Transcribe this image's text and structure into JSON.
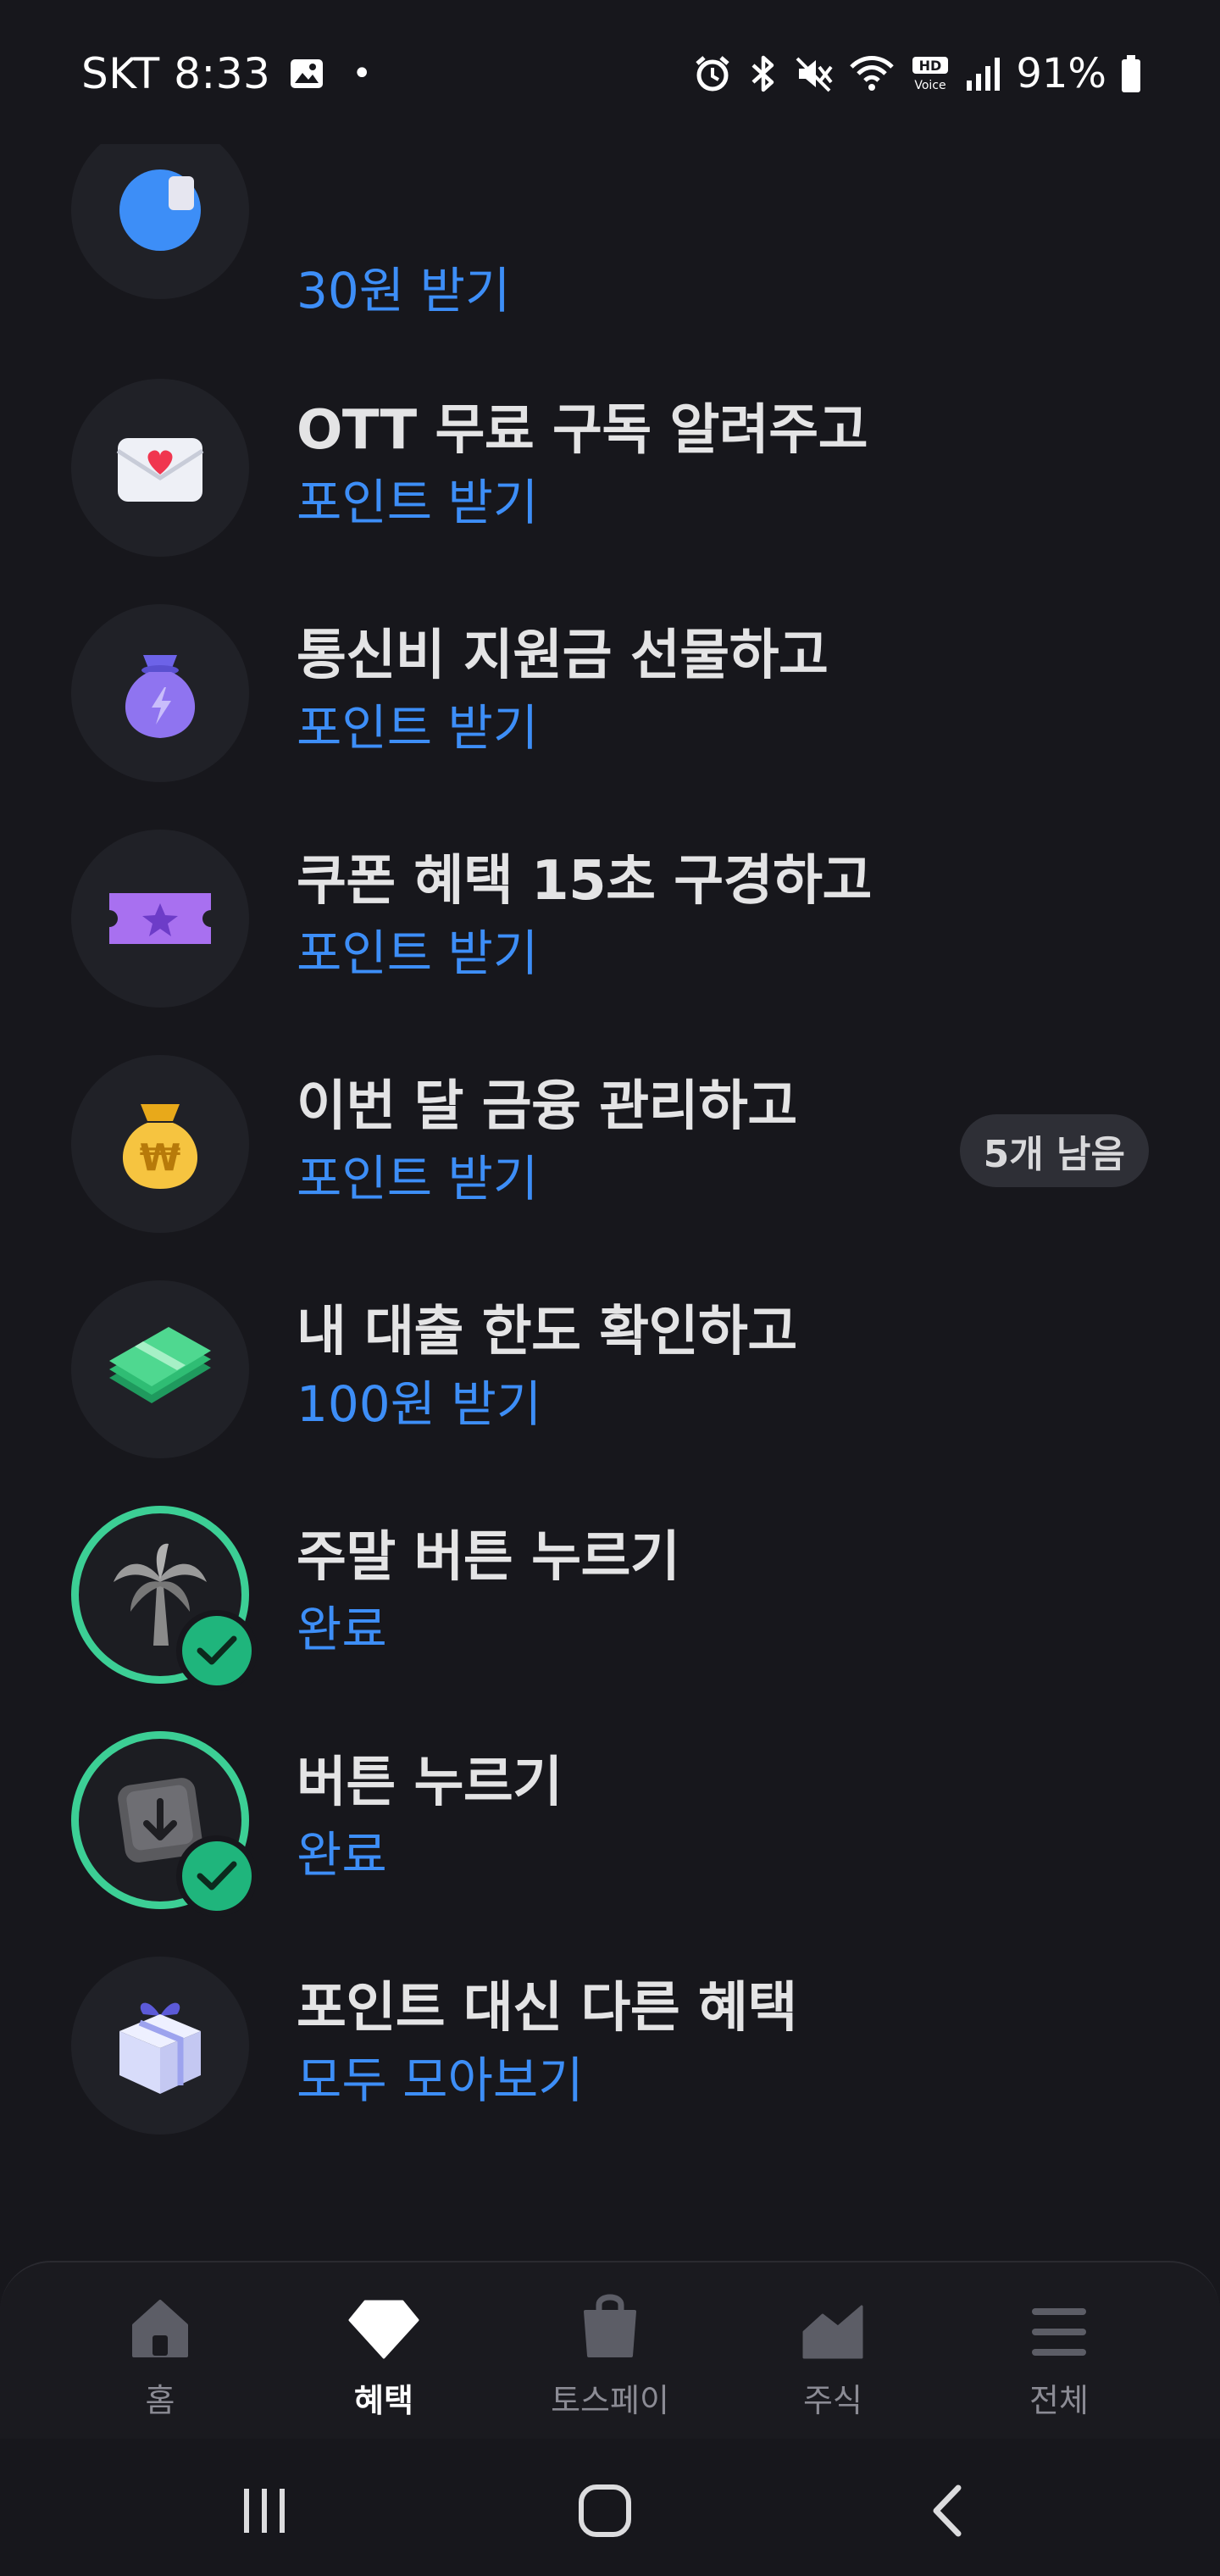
{
  "status_bar": {
    "carrier_time": "SKT 8:33",
    "dot": "•",
    "battery": "91%",
    "icons": [
      "gallery-icon",
      "alarm-icon",
      "bluetooth-icon",
      "mute-icon",
      "wifi-icon",
      "hd-voice-icon",
      "signal-icon",
      "battery-icon"
    ]
  },
  "list": {
    "items": [
      {
        "title": "",
        "subtitle": "30원 받기",
        "icon": "partial-icon",
        "done": false
      },
      {
        "title": "OTT 무료 구독 알려주고",
        "subtitle": "포인트 받기",
        "icon": "heart-envelope-icon",
        "done": false
      },
      {
        "title": "통신비 지원금 선물하고",
        "subtitle": "포인트 받기",
        "icon": "lightning-pouch-icon",
        "done": false
      },
      {
        "title": "쿠폰 혜택 15초 구경하고",
        "subtitle": "포인트 받기",
        "icon": "star-ticket-icon",
        "done": false
      },
      {
        "title": "이번 달 금융 관리하고",
        "subtitle": "포인트 받기",
        "icon": "won-money-bag-icon",
        "done": false,
        "badge": "5개 남음"
      },
      {
        "title": "내 대출 한도 확인하고",
        "subtitle": "100원 받기",
        "icon": "cash-stack-icon",
        "done": false
      },
      {
        "title": "주말 버튼 누르기",
        "subtitle": "완료",
        "icon": "palm-tree-icon",
        "done": true
      },
      {
        "title": "버튼 누르기",
        "subtitle": "완료",
        "icon": "arrow-key-icon",
        "done": true
      },
      {
        "title": "포인트 대신 다른 혜택",
        "subtitle": "모두 모아보기",
        "icon": "gift-box-icon",
        "done": false
      }
    ]
  },
  "tab_bar": {
    "tabs": [
      {
        "label": "홈",
        "icon": "home-icon",
        "active": false
      },
      {
        "label": "혜택",
        "icon": "diamond-icon",
        "active": true
      },
      {
        "label": "토스페이",
        "icon": "shopping-bag-icon",
        "active": false
      },
      {
        "label": "주식",
        "icon": "stock-chart-icon",
        "active": false
      },
      {
        "label": "전체",
        "icon": "menu-icon",
        "active": false
      }
    ]
  },
  "nav_bar": {
    "buttons": [
      "recent-apps-icon",
      "home-button-icon",
      "back-icon"
    ]
  },
  "colors": {
    "background": "#17171c",
    "accent_blue": "#3d8ef7",
    "done_green": "#3ccf95",
    "title_text": "#e4e4e5"
  }
}
